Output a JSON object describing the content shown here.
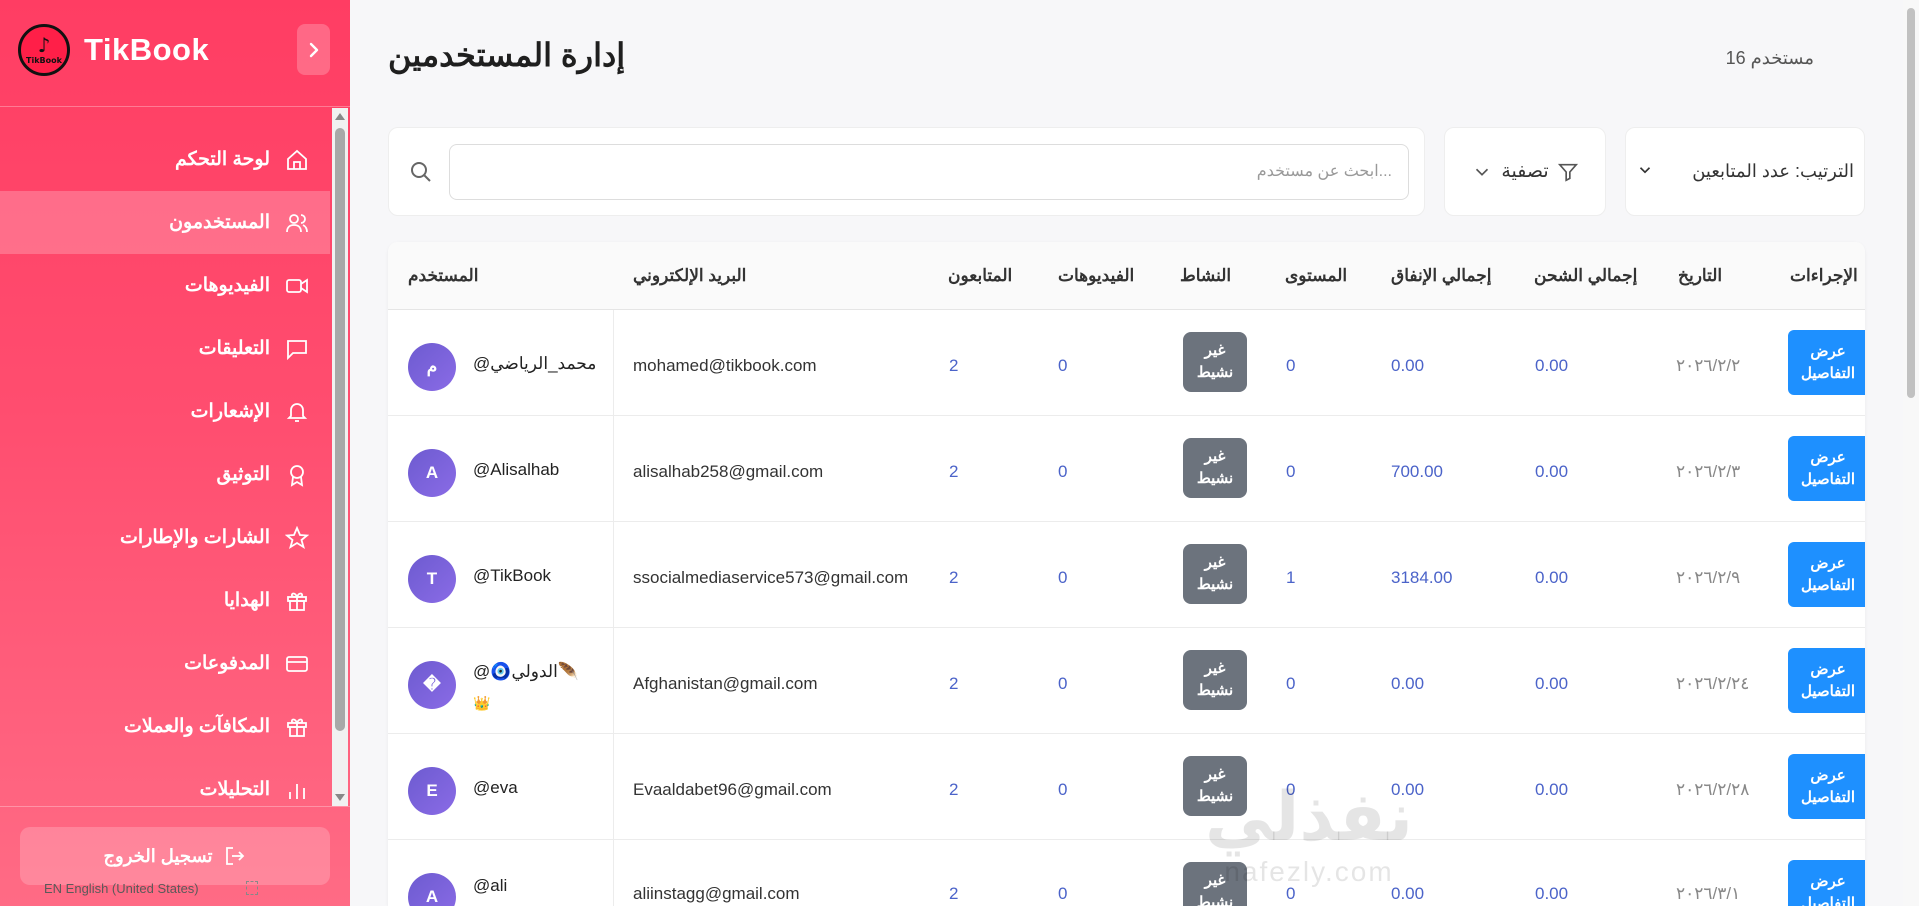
{
  "brand": {
    "name": "TikBook",
    "logo_text": "TikBook"
  },
  "sidebar": {
    "items": [
      {
        "label": "لوحة التحكم",
        "icon": "home-icon",
        "active": false
      },
      {
        "label": "المستخدمون",
        "icon": "users-icon",
        "active": true
      },
      {
        "label": "الفيديوهات",
        "icon": "video-icon",
        "active": false
      },
      {
        "label": "التعليقات",
        "icon": "comment-icon",
        "active": false
      },
      {
        "label": "الإشعارات",
        "icon": "bell-icon",
        "active": false
      },
      {
        "label": "التوثيق",
        "icon": "award-icon",
        "active": false
      },
      {
        "label": "الشارات والإطارات",
        "icon": "star-icon",
        "active": false
      },
      {
        "label": "الهدايا",
        "icon": "gift-icon",
        "active": false
      },
      {
        "label": "المدفوعات",
        "icon": "credit-card-icon",
        "active": false
      },
      {
        "label": "المكافآت والعملات",
        "icon": "gift-icon",
        "active": false
      },
      {
        "label": "التحليلات",
        "icon": "bar-chart-icon",
        "active": false
      }
    ],
    "logout_label": "تسجيل الخروج",
    "language": "EN English (United States)"
  },
  "header": {
    "title": "إدارة المستخدمين",
    "user_count": "مستخدم 16"
  },
  "search": {
    "placeholder": "...ابحث عن مستخدم",
    "value": ""
  },
  "filter": {
    "label": "تصفية"
  },
  "sort": {
    "label": "الترتيب: عدد المتابعين"
  },
  "table": {
    "headers": {
      "user": "المستخدم",
      "email": "البريد الإلكتروني",
      "followers": "المتابعون",
      "videos": "الفيديوهات",
      "activity": "النشاط",
      "level": "المستوى",
      "total_spent": "إجمالي الإنفاق",
      "total_charged": "إجمالي الشحن",
      "date": "التاريخ",
      "actions": "الإجراءات"
    },
    "rows": [
      {
        "avatar": "م",
        "username": "@محمد_الرياضي",
        "username_extra": "",
        "email": "mohamed@tikbook.com",
        "followers": "2",
        "videos": "0",
        "activity_line1": "غير",
        "activity_line2": "نشيط",
        "level": "0",
        "total_spent": "0.00",
        "total_charged": "0.00",
        "date": "٢٠٢٦/٢/٢",
        "action_line1": "عرض",
        "action_line2": "التفاصيل"
      },
      {
        "avatar": "A",
        "username": "@Alisalhab",
        "username_extra": "",
        "email": "alisalhab258@gmail.com",
        "followers": "2",
        "videos": "0",
        "activity_line1": "غير",
        "activity_line2": "نشيط",
        "level": "0",
        "total_spent": "700.00",
        "total_charged": "0.00",
        "date": "٢٠٢٦/٢/٣",
        "action_line1": "عرض",
        "action_line2": "التفاصيل"
      },
      {
        "avatar": "T",
        "username": "@TikBook",
        "username_extra": "",
        "email": "ssocialmediaservice573@gmail.com",
        "followers": "2",
        "videos": "0",
        "activity_line1": "غير",
        "activity_line2": "نشيط",
        "level": "1",
        "total_spent": "3184.00",
        "total_charged": "0.00",
        "date": "٢٠٢٦/٢/٩",
        "action_line1": "عرض",
        "action_line2": "التفاصيل"
      },
      {
        "avatar": "�",
        "username": "@🧿الدولي🪶",
        "username_extra": "👑",
        "email": "Afghanistan@gmail.com",
        "followers": "2",
        "videos": "0",
        "activity_line1": "غير",
        "activity_line2": "نشيط",
        "level": "0",
        "total_spent": "0.00",
        "total_charged": "0.00",
        "date": "٢٠٢٦/٢/٢٤",
        "action_line1": "عرض",
        "action_line2": "التفاصيل"
      },
      {
        "avatar": "E",
        "username": "@eva",
        "username_extra": "",
        "email": "Evaaldabet96@gmail.com",
        "followers": "2",
        "videos": "0",
        "activity_line1": "غير",
        "activity_line2": "نشيط",
        "level": "0",
        "total_spent": "0.00",
        "total_charged": "0.00",
        "date": "٢٠٢٦/٢/٢٨",
        "action_line1": "عرض",
        "action_line2": "التفاصيل"
      },
      {
        "avatar": "A",
        "username": "@ali",
        "username_extra": "",
        "email": "aliinstagg@gmail.com",
        "followers": "2",
        "videos": "0",
        "activity_line1": "غير",
        "activity_line2": "نشيط",
        "level": "0",
        "total_spent": "0.00",
        "total_charged": "0.00",
        "date": "٢٠٢٦/٣/١",
        "action_line1": "عرض",
        "action_line2": "التفاصيل"
      }
    ]
  },
  "watermark": {
    "arabic": "نفذلي",
    "latin": "nafezly.com"
  },
  "colors": {
    "sidebar": "#ff4d6f",
    "accent_button": "#1e90ff",
    "number_blue": "#4b63c9",
    "badge_gray": "#6c737d"
  }
}
